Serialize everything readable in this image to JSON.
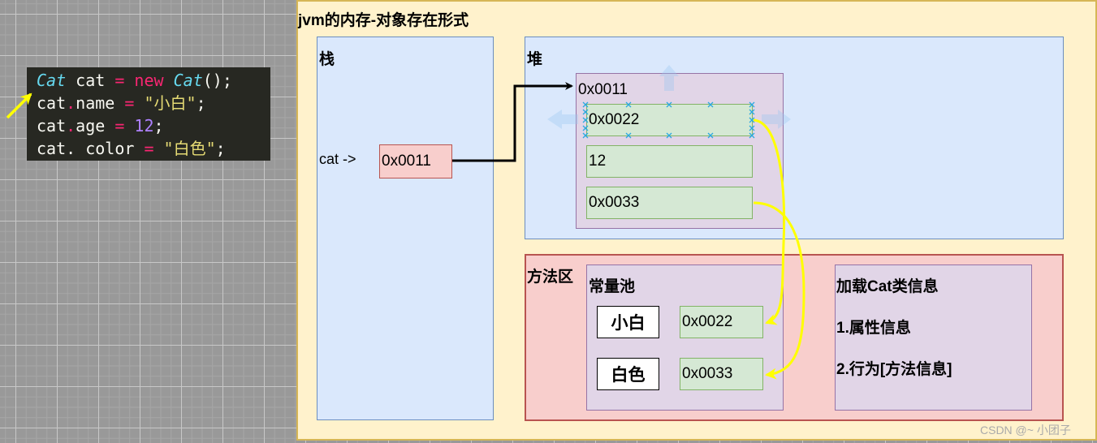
{
  "code": {
    "lines": [
      {
        "type": "Cat",
        "var": " cat ",
        "eq": "=",
        "kw": " new ",
        "ctor": "Cat",
        "rest": "();"
      },
      {
        "obj": "cat",
        "dot": ".",
        "field": "name ",
        "eq": "=",
        "value": " \"小白\"",
        "end": ";"
      },
      {
        "obj": "cat",
        "dot": ".",
        "field": "age ",
        "eq": "=",
        "value": " 12",
        "end": ";"
      },
      {
        "obj": "cat",
        "dot": ". ",
        "field": "color ",
        "eq": "=",
        "value": " \"白色\"",
        "end": ";"
      }
    ]
  },
  "diagram": {
    "title": "jvm的内存-对象存在形式",
    "stack": {
      "label": "栈",
      "var_label": "cat ->",
      "ref_value": "0x0011"
    },
    "heap": {
      "label": "堆",
      "object": {
        "address": "0x0011",
        "fields": [
          "0x0022",
          "12",
          "0x0033"
        ]
      }
    },
    "method_area": {
      "label": "方法区",
      "constant_pool": {
        "label": "常量池",
        "entries": [
          {
            "string": "小白",
            "address": "0x0022"
          },
          {
            "string": "白色",
            "address": "0x0033"
          }
        ]
      },
      "class_info": {
        "title": "加载Cat类信息",
        "items": [
          "1.属性信息",
          "2.行为[方法信息]"
        ]
      }
    },
    "colors": {
      "arrow_pointer": "#000000",
      "arrow_string_ref": "#ffff00",
      "annotation_arrow": "#ffff00"
    }
  },
  "watermark": "CSDN @~ 小团子"
}
